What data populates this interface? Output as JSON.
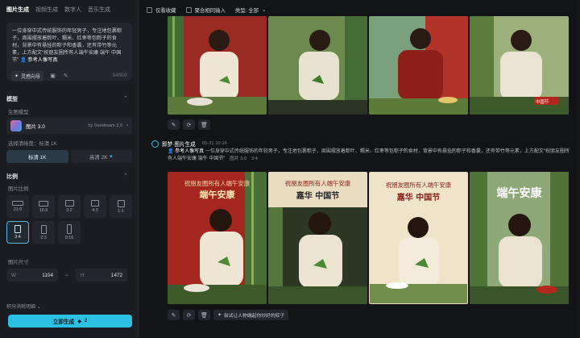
{
  "left": {
    "tabs": [
      "图片生成",
      "视频生成",
      "数字人",
      "音乐生成"
    ],
    "prompt": {
      "text": "一位身穿中式传统服饰的年轻男子，专注地包裹粽子，周围摆放着粽叶、糯米、红枣等包粽子的食材，背景中有悬挂的粽子和香囊，还有带竹等元素，上方配文“祝朋友圈所有人端午安康 端午 中国节”",
      "ref_label": "参考人像写真",
      "chip_label": "灵感向导",
      "counter": "94/800"
    },
    "model_section": {
      "title": "模型",
      "sub": "生图模型",
      "model_name": "图片 3.0",
      "model_by": "by Seedream 3.0"
    },
    "quality": {
      "label": "选择清晰度：标清 1K",
      "options": [
        "标清 1K",
        "高清 2K"
      ]
    },
    "ratio_section": {
      "title": "比例",
      "sub": "图片比例",
      "ratios": [
        "21:9",
        "16:9",
        "3:2",
        "4:3",
        "1:1",
        "3:4",
        "2:3",
        "9:16"
      ],
      "selected": "3:4"
    },
    "size": {
      "label": "图片尺寸",
      "w_key": "W",
      "w_value": "1104",
      "h_key": "H",
      "h_value": "1472"
    },
    "credits_label": "积分消耗明细",
    "generate": {
      "label": "立即生成",
      "cost": "2"
    }
  },
  "main": {
    "filters": [
      "仅看收藏",
      "聚合相同输入",
      "类型: 全部"
    ],
    "entry": {
      "title": "即梦·图片生成",
      "time": "05-31  10:16",
      "user_ref": "参考人像写真",
      "prompt": "一位身穿中式传统服饰的年轻男子，专注地包裹粽子，周围摆放着粽叶、糯米、红枣等包粽子的食材，背景中有悬挂的粽子和香囊，还有带竹等元素，上方配文“祝朋友圈所有人端午安康 端午 中国节”",
      "model": "图片 3.0",
      "ratio": "3:4"
    },
    "captions": {
      "img1_line1": "祝朋友圈所有人端午安康",
      "img1_line2": "端午安康",
      "img2_line1": "祝朋友圈所有人端午安康",
      "img2_line2": "嘉华  中国节",
      "img3_line1": "祝朋友圈所有人端午安康",
      "img3_line2": "嘉华    中国节",
      "img4_line1": "端午安康",
      "top4_badge": "中国节"
    },
    "suggest_label": "尝试让人物端起你炒好的粽子"
  },
  "colors": {
    "accent": "#2bc0e4",
    "bg": "#14161a",
    "panel": "#1b1d22"
  }
}
